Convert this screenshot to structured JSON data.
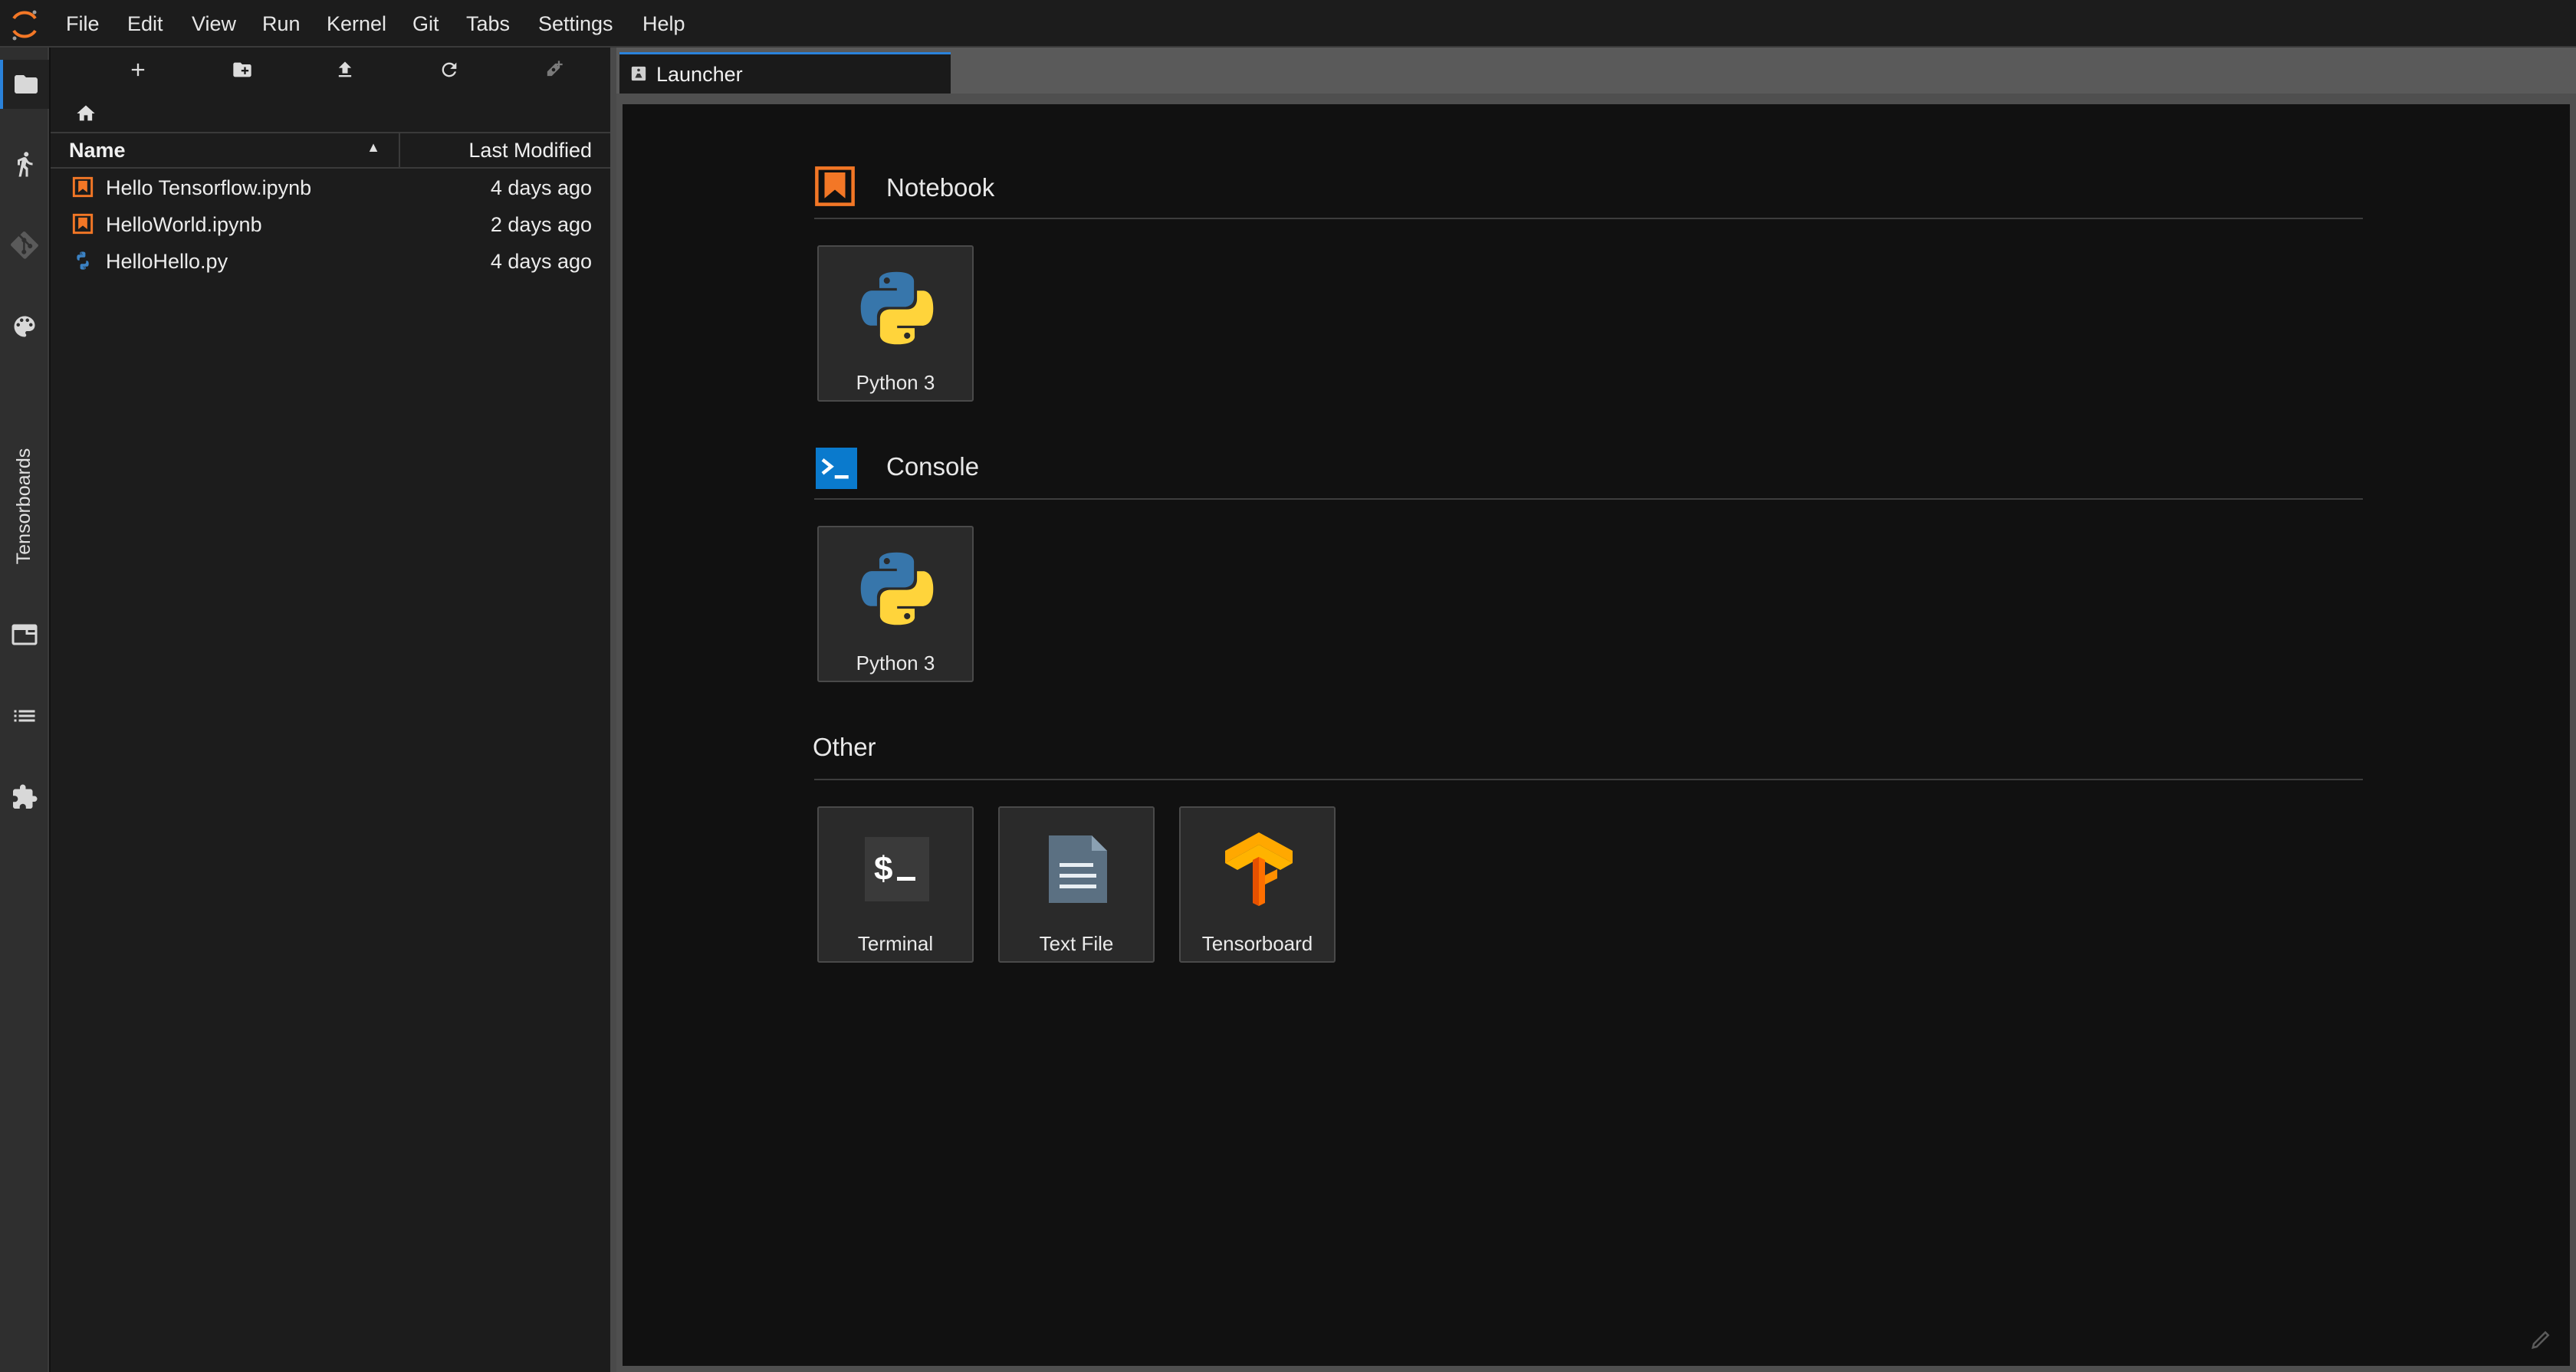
{
  "menubar": {
    "items": [
      "File",
      "Edit",
      "View",
      "Run",
      "Kernel",
      "Git",
      "Tabs",
      "Settings",
      "Help"
    ]
  },
  "sidebar": {
    "tensorboards_label": "Tensorboards",
    "icons": [
      "folder-icon",
      "running-icon",
      "git-icon",
      "palette-icon",
      "tabs-icon",
      "toc-icon",
      "extension-icon"
    ]
  },
  "filebrowser": {
    "toolbar": [
      "new-launcher-icon",
      "new-folder-icon",
      "upload-icon",
      "refresh-icon",
      "new-git-icon"
    ],
    "columns": {
      "name": "Name",
      "modified": "Last Modified"
    },
    "files": [
      {
        "name": "Hello Tensorflow.ipynb",
        "modified": "4 days ago",
        "type": "notebook"
      },
      {
        "name": "HelloWorld.ipynb",
        "modified": "2 days ago",
        "type": "notebook"
      },
      {
        "name": "HelloHello.py",
        "modified": "4 days ago",
        "type": "python"
      }
    ]
  },
  "tabs": [
    {
      "label": "Launcher",
      "active": true
    }
  ],
  "launcher": {
    "sections": [
      {
        "title": "Notebook",
        "cards": [
          {
            "label": "Python 3"
          }
        ]
      },
      {
        "title": "Console",
        "cards": [
          {
            "label": "Python 3"
          }
        ]
      },
      {
        "title": "Other",
        "cards": [
          {
            "label": "Terminal"
          },
          {
            "label": "Text File"
          },
          {
            "label": "Tensorboard"
          }
        ]
      }
    ]
  },
  "colors": {
    "accent": "#2a82da",
    "notebook_orange": "#f37726",
    "python_blue": "#3572a5",
    "python_yellow": "#ffd43b",
    "tensorflow_orange": "#ff8f00"
  }
}
